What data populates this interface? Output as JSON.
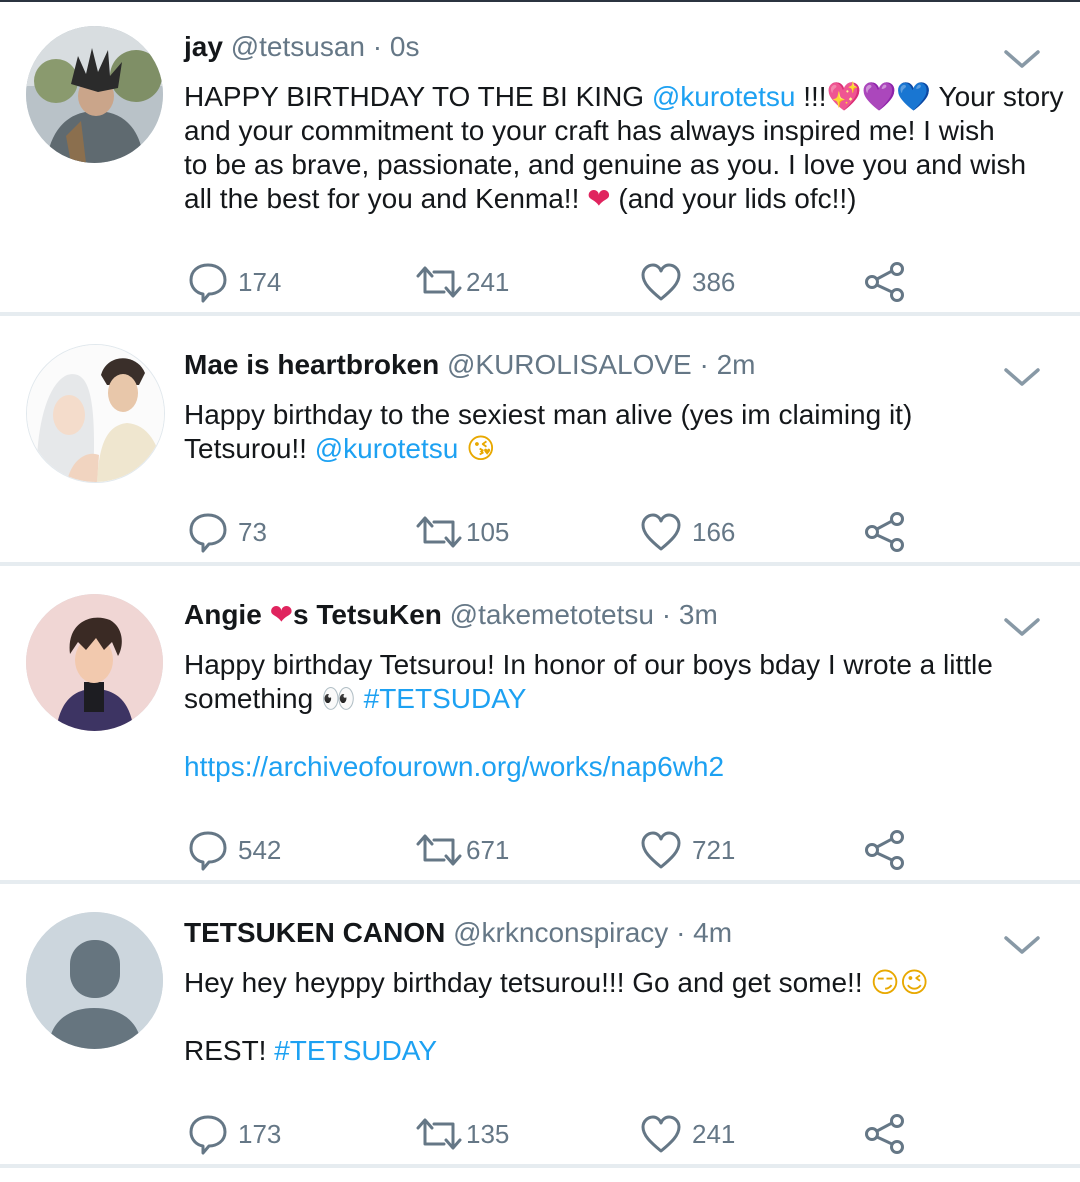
{
  "tweets": [
    {
      "name": "jay",
      "handle": "@tetsusan",
      "time": "0s",
      "lines": [
        [
          {
            "t": "HAPPY BIRTHDAY TO THE BI KING "
          },
          {
            "t": "@kurotetsu",
            "c": "link"
          },
          {
            "t": " !!!"
          },
          {
            "t": "💖",
            "c": "emoji e-pink"
          },
          {
            "t": "💜",
            "c": "emoji e-purple"
          },
          {
            "t": "💙",
            "c": "emoji e-blue"
          },
          {
            "t": " Your story"
          }
        ],
        [
          {
            "t": "and your commitment to your craft has always inspired me! I wish"
          }
        ],
        [
          {
            "t": "to be as brave, passionate, and genuine as you. I love you and wish"
          }
        ],
        [
          {
            "t": "all the best for you and Kenma!! "
          },
          {
            "t": "❤",
            "c": "emoji e-red"
          },
          {
            "t": " (and your lids ofc!!)"
          }
        ]
      ],
      "replies": "174",
      "retweets": "241",
      "likes": "386"
    },
    {
      "name": "Mae is heartbroken",
      "handle": "@KUROLISALOVE",
      "time": "2m",
      "lines": [
        [
          {
            "t": "Happy birthday to the sexiest man alive (yes im claiming it)"
          }
        ],
        [
          {
            "t": "Tetsurou!! "
          },
          {
            "t": "@kurotetsu",
            "c": "link"
          },
          {
            "t": " "
          },
          {
            "t": "😘",
            "c": "emoji e-yellow"
          }
        ]
      ],
      "replies": "73",
      "retweets": "105",
      "likes": "166"
    },
    {
      "name_parts": [
        {
          "t": "Angie "
        },
        {
          "t": "❤",
          "c": "heart-inline"
        },
        {
          "t": "s TetsuKen"
        }
      ],
      "handle": "@takemetotetsu",
      "time": "3m",
      "lines": [
        [
          {
            "t": "Happy birthday Tetsurou! In honor of our boys bday I wrote a little"
          }
        ],
        [
          {
            "t": "something "
          },
          {
            "t": "👀",
            "c": "emoji"
          },
          {
            "t": " "
          },
          {
            "t": "#TETSUDAY",
            "c": "link"
          }
        ],
        [
          {
            "t": " "
          }
        ],
        [
          {
            "t": "https://archiveofourown.org/works/nap6wh2",
            "c": "link"
          }
        ]
      ],
      "replies": "542",
      "retweets": "671",
      "likes": "721"
    },
    {
      "name": "TETSUKEN CANON",
      "handle": "@krknconspiracy",
      "time": "4m",
      "lines": [
        [
          {
            "t": "Hey hey heyppy birthday tetsurou!!! Go and get some!! "
          },
          {
            "t": "😏",
            "c": "emoji e-yellow"
          },
          {
            "t": "😉",
            "c": "emoji e-yellow"
          }
        ],
        [
          {
            "t": " "
          }
        ],
        [
          {
            "t": "REST! "
          },
          {
            "t": "#TETSUDAY",
            "c": "link"
          }
        ]
      ],
      "replies": "173",
      "retweets": "135",
      "likes": "241"
    }
  ],
  "colors": {
    "link": "#1da1f2",
    "muted": "#657786",
    "separator": "#e6ecf0"
  },
  "icons": [
    "reply-icon",
    "retweet-icon",
    "like-icon",
    "share-icon",
    "chevron-down-icon"
  ]
}
